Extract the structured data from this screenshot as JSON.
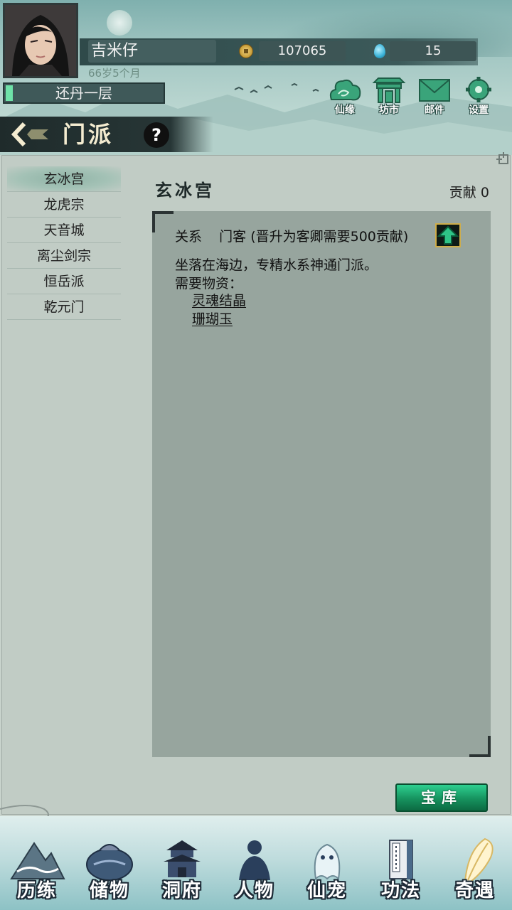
{
  "player": {
    "name": "吉米仔",
    "age": "66岁5个月",
    "realm": "还丹一层",
    "coins": "107065",
    "jade": "15"
  },
  "top_buttons": [
    {
      "label": "仙缘",
      "icon": "cloud-icon"
    },
    {
      "label": "坊市",
      "icon": "market-gate-icon"
    },
    {
      "label": "邮件",
      "icon": "mail-icon"
    },
    {
      "label": "设置",
      "icon": "gear-icon"
    }
  ],
  "page": {
    "title": "门派",
    "help": "?"
  },
  "sects": [
    {
      "name": "玄冰宫",
      "active": true
    },
    {
      "name": "龙虎宗",
      "active": false
    },
    {
      "name": "天音城",
      "active": false
    },
    {
      "name": "离尘剑宗",
      "active": false
    },
    {
      "name": "恒岳派",
      "active": false
    },
    {
      "name": "乾元门",
      "active": false
    }
  ],
  "detail": {
    "title": "玄冰宫",
    "contribution": "贡献 0",
    "relation": "关系    门客 (晋升为客卿需要500贡献)",
    "description": "坐落在海边，专精水系神通门派。",
    "materials_label": "需要物资：",
    "materials": [
      "灵魂结晶",
      "珊瑚玉"
    ]
  },
  "treasury_button": "宝库",
  "bottom_nav": [
    {
      "label": "历练",
      "icon": "mountain-icon"
    },
    {
      "label": "储物",
      "icon": "pouch-icon"
    },
    {
      "label": "洞府",
      "icon": "pagoda-icon"
    },
    {
      "label": "人物",
      "icon": "person-icon"
    },
    {
      "label": "仙宠",
      "icon": "spirit-pet-icon"
    },
    {
      "label": "功法",
      "icon": "scroll-book-icon"
    },
    {
      "label": "奇遇",
      "icon": "feather-icon"
    }
  ],
  "colors": {
    "accent_green": "#16925e",
    "header_teal": "#7fb0ae",
    "panel_bg": "#c1ccc5",
    "detail_bg": "#97a59e"
  }
}
